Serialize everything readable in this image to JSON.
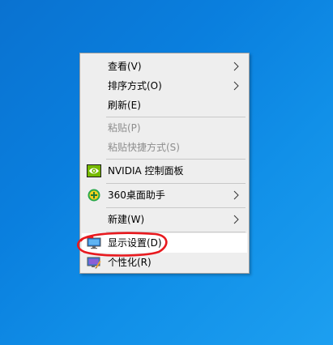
{
  "desktop": {
    "background_color": "#0a7fde"
  },
  "context_menu": {
    "items": [
      {
        "label": "查看(V)",
        "submenu": true
      },
      {
        "label": "排序方式(O)",
        "submenu": true
      },
      {
        "label": "刷新(E)"
      },
      {
        "label": "粘贴(P)",
        "disabled": true
      },
      {
        "label": "粘贴快捷方式(S)",
        "disabled": true
      },
      {
        "label": "NVIDIA 控制面板",
        "icon": "nvidia-icon"
      },
      {
        "label": "360桌面助手",
        "icon": "360-desktop-assistant-icon",
        "submenu": true
      },
      {
        "label": "新建(W)",
        "submenu": true
      },
      {
        "label": "显示设置(D)",
        "icon": "display-settings-icon",
        "highlighted": true
      },
      {
        "label": "个性化(R)",
        "icon": "personalize-icon"
      }
    ]
  },
  "annotation": {
    "color": "#e8191e",
    "target": "显示设置(D)"
  },
  "colors": {
    "menu_background": "#eeeeee",
    "highlight_background": "#ffffff",
    "disabled_text": "#8e8e8e",
    "nvidia_green": "#76b900"
  }
}
